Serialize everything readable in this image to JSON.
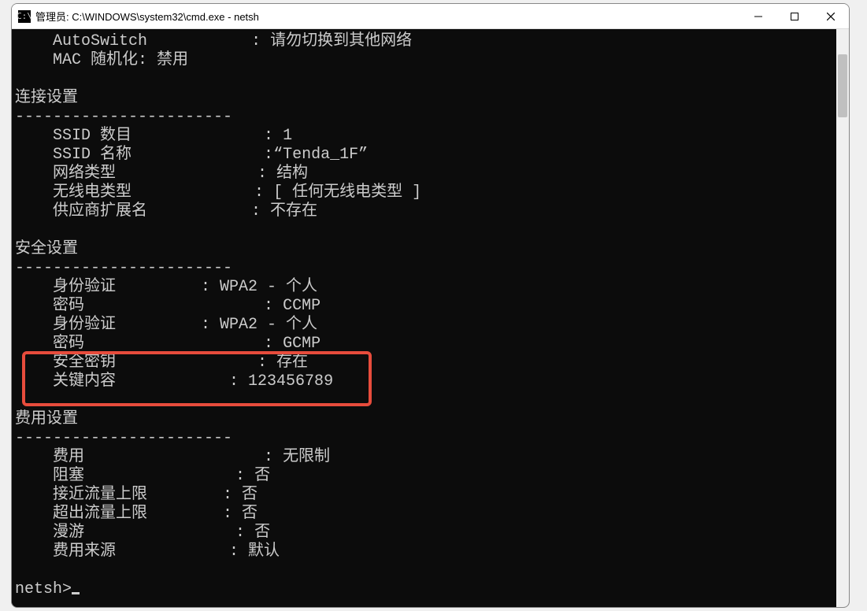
{
  "window_title": "管理员: C:\\WINDOWS\\system32\\cmd.exe - netsh",
  "top_lines": [
    {
      "k": "    AutoSwitch           ",
      "s": ": ",
      "v": "请勿切换到其他网络"
    },
    {
      "k": "    MAC 随机化",
      "s": ": ",
      "v": "禁用"
    }
  ],
  "section_conn": {
    "title": "连接设置",
    "rows": [
      {
        "k": "    SSID 数目              ",
        "s": ": ",
        "v": "1"
      },
      {
        "k": "    SSID 名称              ",
        "s": ":",
        "v": "“Tenda_1F”"
      },
      {
        "k": "    网络类型               ",
        "s": ": ",
        "v": "结构"
      },
      {
        "k": "    无线电类型             ",
        "s": ": ",
        "v": "[ 任何无线电类型 ]"
      },
      {
        "k": "    供应商扩展名           ",
        "s": ": ",
        "v": "不存在"
      }
    ]
  },
  "section_sec": {
    "title": "安全设置",
    "rows": [
      {
        "k": "    身份验证         ",
        "s": ": ",
        "v": "WPA2 - 个人"
      },
      {
        "k": "    密码                   ",
        "s": ": ",
        "v": "CCMP"
      },
      {
        "k": "    身份验证         ",
        "s": ": ",
        "v": "WPA2 - 个人"
      },
      {
        "k": "    密码                   ",
        "s": ": ",
        "v": "GCMP"
      },
      {
        "k": "    安全密钥               ",
        "s": ": ",
        "v": "存在"
      },
      {
        "k": "    关键内容            ",
        "s": ": ",
        "v": "123456789"
      }
    ]
  },
  "section_cost": {
    "title": "费用设置",
    "rows": [
      {
        "k": "    费用                   ",
        "s": ": ",
        "v": "无限制"
      },
      {
        "k": "    阻塞                ",
        "s": ": ",
        "v": "否"
      },
      {
        "k": "    接近流量上限        ",
        "s": ": ",
        "v": "否"
      },
      {
        "k": "    超出流量上限        ",
        "s": ": ",
        "v": "否"
      },
      {
        "k": "    漫游                ",
        "s": ": ",
        "v": "否"
      },
      {
        "k": "    费用来源            ",
        "s": ": ",
        "v": "默认"
      }
    ]
  },
  "divider": "-----------------------",
  "prompt": "netsh>",
  "icon_text": "C:\\"
}
